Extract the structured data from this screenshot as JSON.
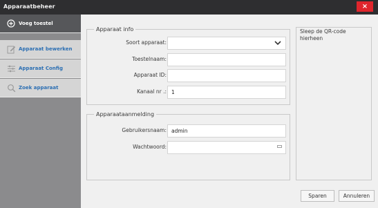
{
  "window": {
    "title": "Apparaatbeheer",
    "close_glyph": "×"
  },
  "sidebar": {
    "items": [
      {
        "label": "Voeg toestel",
        "icon": "plus-circle-icon",
        "active": true
      },
      {
        "label": "Apparaat bewerken",
        "icon": "edit-icon",
        "active": false
      },
      {
        "label": "Apparaat Config",
        "icon": "sliders-icon",
        "active": false
      },
      {
        "label": "Zoek apparaat",
        "icon": "search-icon",
        "active": false
      }
    ]
  },
  "device_info": {
    "legend": "Apparaat info",
    "type_label": "Soort apparaat:",
    "type_value": "",
    "name_label": "Toestelnaam:",
    "name_value": "",
    "id_label": "Apparaat ID:",
    "id_value": "",
    "channels_label": "Kanaal nr .:",
    "channels_value": "1"
  },
  "login": {
    "legend": "Apparaataanmelding",
    "username_label": "Gebruikersnaam:",
    "username_value": "admin",
    "password_label": "Wachtwoord:",
    "password_value": ""
  },
  "qr": {
    "text": "Sleep de QR-code hierheen"
  },
  "buttons": {
    "save": "Sparen",
    "cancel": "Annuleren"
  },
  "colors": {
    "titlebar": "#2e2e30",
    "close": "#e0252c",
    "sidebar_active": "#56575a",
    "sidebar_item": "#d5d5d5",
    "sidebar_text": "#2c6fb3"
  }
}
